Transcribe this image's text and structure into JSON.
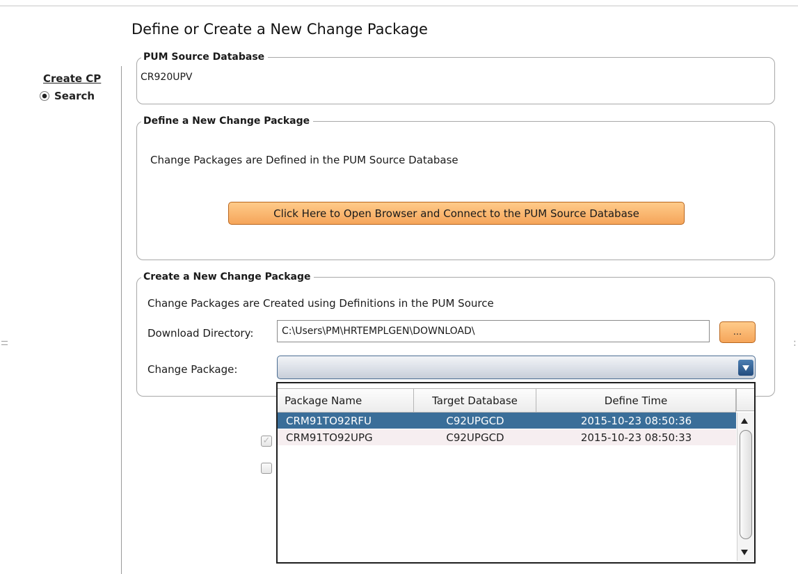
{
  "page": {
    "title": "Define or Create a New Change Package"
  },
  "nav": {
    "link": "Create CP",
    "radio_label": "Search"
  },
  "source_group": {
    "legend": "PUM Source Database",
    "value": "CR920UPV"
  },
  "define_group": {
    "legend": "Define a New Change Package",
    "text": "Change Packages are Defined in the PUM Source Database",
    "button_label": "Click Here to Open Browser and Connect to the PUM Source Database"
  },
  "create_group": {
    "legend": "Create a New Change Package",
    "text": "Change Packages are Created using Definitions in the PUM Source",
    "download_label": "Download Directory:",
    "download_value": "C:\\Users\\PM\\HRTEMPLGEN\\DOWNLOAD\\",
    "browse_label": "...",
    "package_label": "Change Package:",
    "package_value": ""
  },
  "dropdown": {
    "columns": [
      "Package Name",
      "Target Database",
      "Define Time"
    ],
    "rows": [
      [
        "CRM91TO92RFU",
        "C92UPGCD",
        "2015-10-23 08:50:36"
      ],
      [
        "CRM91TO92UPG",
        "C92UPGCD",
        "2015-10-23 08:50:33"
      ]
    ],
    "selected_index": 0
  },
  "checkboxes": {
    "first_checked": true,
    "second_checked": false
  },
  "colors": {
    "accent_button": "#f5a55a",
    "selected_row": "#3a6e99",
    "alt_row": "#f6eef0",
    "dropdown_arrow": "#234d7f"
  },
  "icons": {
    "radio": "radio-selected-icon",
    "dropdown_arrow": "chevron-down-icon",
    "scroll_up": "scroll-up-icon",
    "scroll_down": "scroll-down-icon",
    "check": "checkmark-icon"
  }
}
